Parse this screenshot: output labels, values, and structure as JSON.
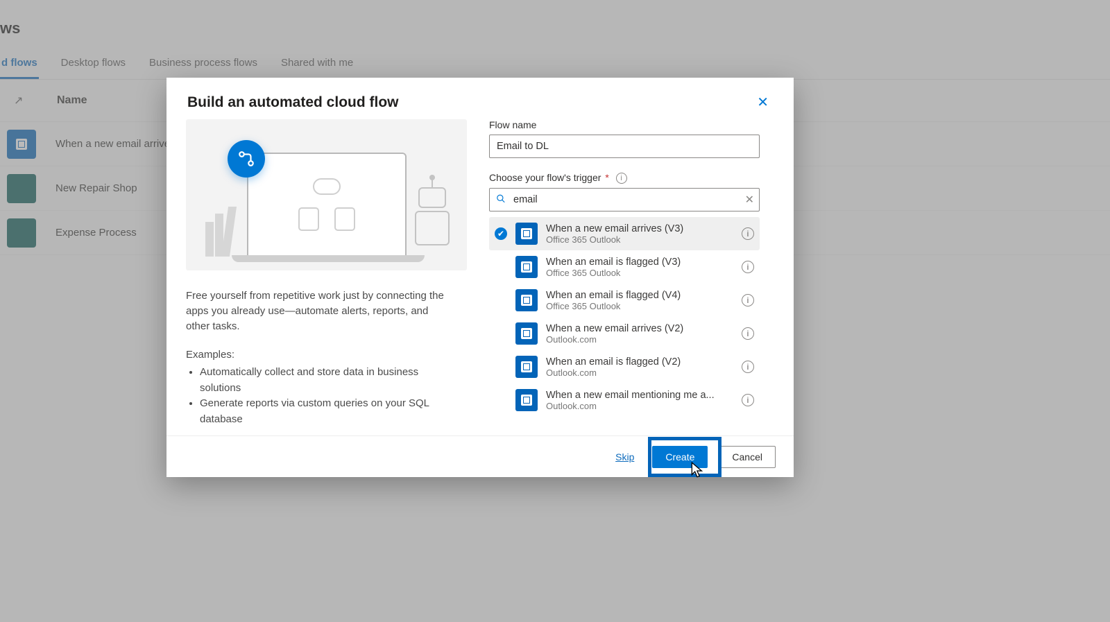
{
  "background": {
    "page_suffix": "ws",
    "tabs": [
      "d flows",
      "Desktop flows",
      "Business process flows",
      "Shared with me"
    ],
    "active_tab_index": 0,
    "list_header": {
      "name": "Name"
    },
    "rows": [
      {
        "name": "When a new email arrives",
        "color": "blue"
      },
      {
        "name": "New Repair Shop",
        "color": "teal"
      },
      {
        "name": "Expense Process",
        "color": "teal"
      }
    ]
  },
  "modal": {
    "title": "Build an automated cloud flow",
    "description": "Free yourself from repetitive work just by connecting the apps you already use—automate alerts, reports, and other tasks.",
    "examples_title": "Examples:",
    "examples": [
      "Automatically collect and store data in business solutions",
      "Generate reports via custom queries on your SQL database"
    ],
    "flow_name_label": "Flow name",
    "flow_name_value": "Email to DL",
    "trigger_label": "Choose your flow's trigger",
    "required_marker": "*",
    "search_value": "email",
    "triggers": [
      {
        "name": "When a new email arrives (V3)",
        "connector": "Office 365 Outlook",
        "selected": true
      },
      {
        "name": "When an email is flagged (V3)",
        "connector": "Office 365 Outlook",
        "selected": false
      },
      {
        "name": "When an email is flagged (V4)",
        "connector": "Office 365 Outlook",
        "selected": false
      },
      {
        "name": "When a new email arrives (V2)",
        "connector": "Outlook.com",
        "selected": false
      },
      {
        "name": "When an email is flagged (V2)",
        "connector": "Outlook.com",
        "selected": false
      },
      {
        "name": "When a new email mentioning me a...",
        "connector": "Outlook.com",
        "selected": false
      }
    ],
    "footer": {
      "skip": "Skip",
      "create": "Create",
      "cancel": "Cancel"
    }
  }
}
